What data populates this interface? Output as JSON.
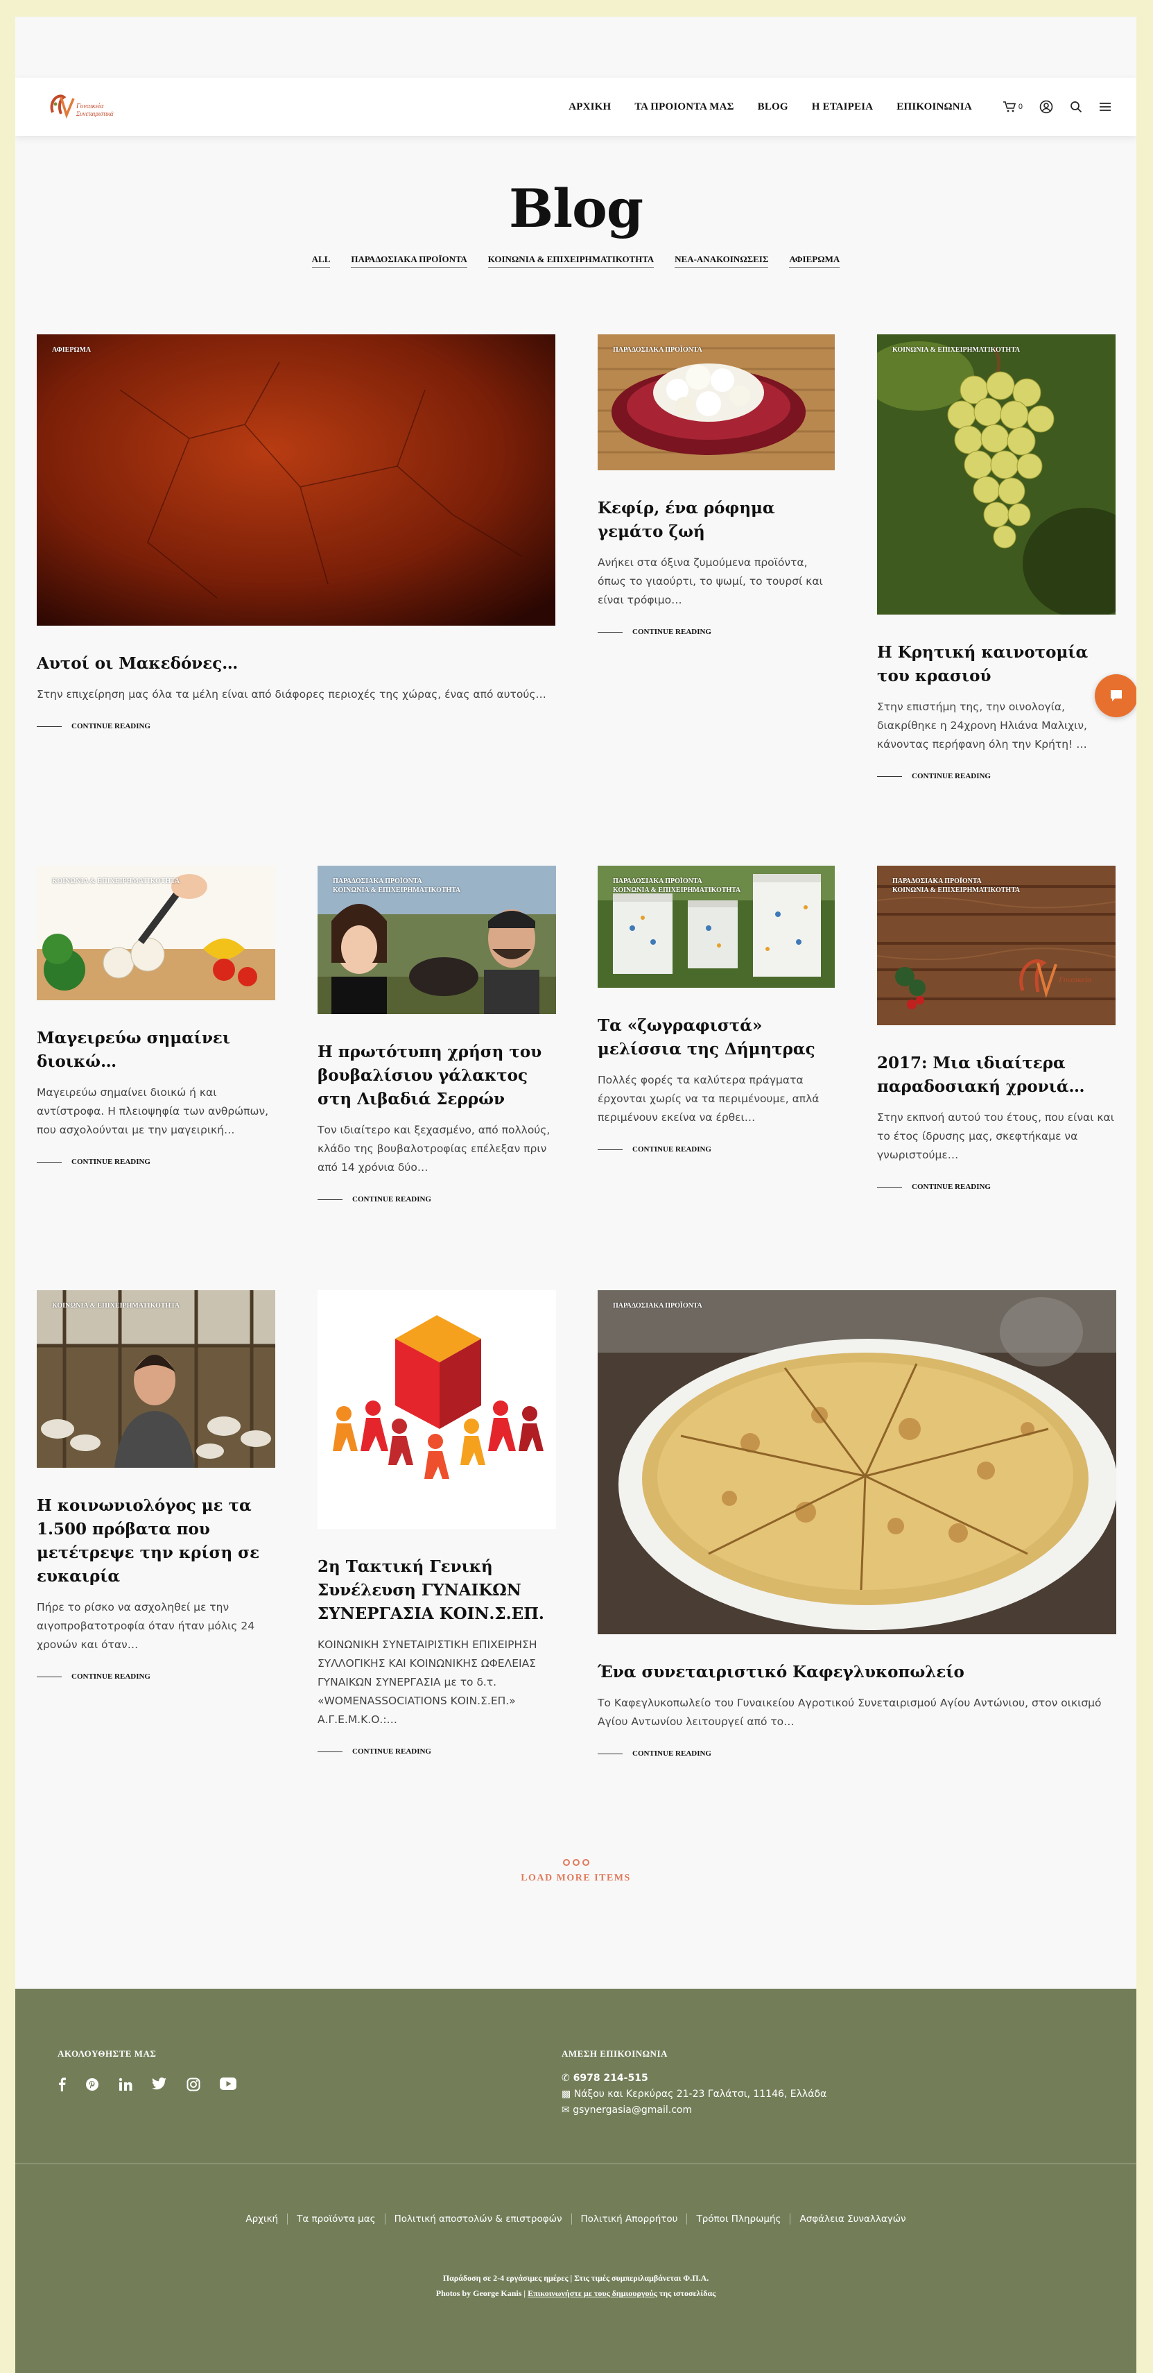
{
  "header": {
    "logo_text": "Γυναικεία Συνεταιριστικά",
    "nav": [
      "ΑΡΧΙΚΗ",
      "ΤΑ ΠΡΟΙΟΝΤΑ ΜΑΣ",
      "BLOG",
      "Η ΕΤΑΙΡΕΙΑ",
      "ΕΠΙΚΟΙΝΩΝΙΑ"
    ],
    "cart_count": "0",
    "icons": [
      "cart-icon",
      "user-icon",
      "search-icon",
      "menu-icon"
    ]
  },
  "page_title": "Blog",
  "filters": [
    "ALL",
    "ΠΑΡΑΔΟΣΙΑΚΑ ΠΡΟΪΟΝΤΑ",
    "ΚΟΙΝΩΝΙΑ & ΕΠΙΧΕΙΡΗΜΑΤΙΚΟΤΗΤΑ",
    "ΝΕΑ-ΑΝΑΚΟΙΝΩΣΕΙΣ",
    "ΑΦΙΕΡΩΜΑ"
  ],
  "continue_label": "CONTINUE READING",
  "posts": [
    {
      "category": "ΑΦΙΕΡΩΜΑ",
      "title": "Αυτοί οι Μακεδόνες…",
      "excerpt": "Στην επιχείρηση μας όλα τα μέλη είναι από διάφορες περιοχές της χώρας, ένας από αυτούς…"
    },
    {
      "category": "ΠΑΡΑΔΟΣΙΑΚΑ ΠΡΟΪΟΝΤΑ",
      "title": "Κεφίρ, ένα ρόφημα γεμάτο ζωή",
      "excerpt": "Ανήκει στα όξινα ζυμούμενα προϊόντα, όπως το γιαούρτι, το ψωμί, το τουρσί και είναι τρόφιμο…"
    },
    {
      "category": "ΚΟΙΝΩΝΙΑ & ΕΠΙΧΕΙΡΗΜΑΤΙΚΟΤΗΤΑ",
      "title": "Η Κρητική καινοτομία του κρασιού",
      "excerpt": "Στην επιστήμη της, την οινολογία, διακρίθηκε η 24χρονη Ηλιάνα Μαλιχιν, κάνοντας περήφανη όλη την Κρήτη! …"
    },
    {
      "category": "ΚΟΙΝΩΝΙΑ & ΕΠΙΧΕΙΡΗΜΑΤΙΚΟΤΗΤΑ",
      "title": "Μαγειρεύω σημαίνει διοικώ…",
      "excerpt": "Μαγειρεύω σημαίνει διοικώ ή και αντίστροφα. Η πλειοψηφία των ανθρώπων, που ασχολούνται με την μαγειρική…"
    },
    {
      "category": "ΠΑΡΑΔΟΣΙΑΚΑ ΠΡΟΪΟΝΤΑ\nΚΟΙΝΩΝΙΑ & ΕΠΙΧΕΙΡΗΜΑΤΙΚΟΤΗΤΑ",
      "title": "Η πρωτότυπη χρήση του βουβαλίσιου γάλακτος στη Λιβαδιά Σερρών",
      "excerpt": "Τον ιδιαίτερο και ξεχασμένο, από πολλούς, κλάδο της βουβαλοτροφίας επέλεξαν πριν από 14 χρόνια δύο…"
    },
    {
      "category": "ΠΑΡΑΔΟΣΙΑΚΑ ΠΡΟΪΟΝΤΑ\nΚΟΙΝΩΝΙΑ & ΕΠΙΧΕΙΡΗΜΑΤΙΚΟΤΗΤΑ",
      "title": "Τα «ζωγραφιστά» μελίσσια της Δήμητρας",
      "excerpt": "Πολλές φορές τα καλύτερα πράγματα έρχονται χωρίς να τα περιμένουμε, απλά περιμένουν εκείνα να έρθει…"
    },
    {
      "category": "ΠΑΡΑΔΟΣΙΑΚΑ ΠΡΟΪΟΝΤΑ\nΚΟΙΝΩΝΙΑ & ΕΠΙΧΕΙΡΗΜΑΤΙΚΟΤΗΤΑ",
      "title": "2017: Μια ιδιαίτερα παραδοσιακή χρονιά…",
      "excerpt": "Στην εκπνοή αυτού του έτους, που είναι και το έτος ίδρυσης μας, σκεφτήκαμε να γνωριστούμε…"
    },
    {
      "category": "ΚΟΙΝΩΝΙΑ & ΕΠΙΧΕΙΡΗΜΑΤΙΚΟΤΗΤΑ",
      "title": "Η κοινωνιολόγος με τα 1.500 πρόβατα που μετέτρεψε την κρίση σε ευκαιρία",
      "excerpt": "Πήρε το ρίσκο να ασχοληθεί με την αιγοπροβατοτροφία όταν ήταν μόλις 24 χρονών και όταν…"
    },
    {
      "category": "",
      "title": "2η Τακτική Γενική Συνέλευση ΓΥΝΑΙΚΩΝ ΣΥΝΕΡΓΑΣΙΑ ΚΟΙΝ.Σ.ΕΠ.",
      "excerpt": "ΚΟΙΝΩΝΙΚΗ ΣΥΝΕΤΑΙΡΙΣΤΙΚΗ ΕΠΙΧΕΙΡΗΣΗ ΣΥΛΛΟΓΙΚΗΣ ΚΑΙ ΚΟΙΝΩΝΙΚΗΣ ΩΦΕΛΕΙΑΣ ΓΥΝΑΙΚΩΝ ΣΥΝΕΡΓΑΣΙΑ με το δ.τ. «WOMENASSOCIATIONS ΚΟΙΝ.Σ.ΕΠ.» Α.Γ.Ε.Μ.Κ.Ο.:…"
    },
    {
      "category": "ΠΑΡΑΔΟΣΙΑΚΑ ΠΡΟΪΟΝΤΑ",
      "title": "Ένα συνεταιριστικό Καφεγλυκοπωλείο",
      "excerpt": "Το Καφεγλυκοπωλείο του Γυναικείου Αγροτικού Συνεταιρισμού Αγίου Αντώνιου, στον οικισμό Αγίου Αντωνίου λειτουργεί από το…"
    }
  ],
  "load_more": "LOAD MORE ITEMS",
  "footer": {
    "follow_heading": "ΑΚΟΛΟΥΘΗΣΤΕ ΜΑΣ",
    "social_icons": [
      "facebook-icon",
      "pinterest-icon",
      "linkedin-icon",
      "twitter-icon",
      "instagram-icon",
      "youtube-icon"
    ],
    "contact_heading": "ΑΜΕΣΗ ΕΠΙΚΟΙΝΩΝΙΑ",
    "phone": "6978 214-515",
    "address": "Νάξου και Κερκύρας 21-23 Γαλάτσι, 11146, Ελλάδα",
    "email": "gsynergasia@gmail.com",
    "links": [
      "Αρχική",
      "Τα προϊόντα μας",
      "Πολιτική αποστολών & επιστροφών",
      "Πολιτική Απορρήτου",
      "Τρόποι Πληρωμής",
      "Ασφάλεια Συναλλαγών"
    ],
    "note_line1": "Παράδοση σε 2-4 εργάσιμες ημέρες | Στις τιμές συμπεριλαμβάνεται Φ.Π.Α.",
    "note_line2_prefix": "Photos by George Kanis | ",
    "note_line2_link": "Επικοινωνήστε με τους δημιουργούς",
    "note_line2_suffix": " της ιστοσελίδας"
  },
  "colors": {
    "accent": "#e0795b",
    "footer_bg": "#737e59",
    "page_bg": "#f8f8f8",
    "outer_bg": "#f3f2cc",
    "chat": "#e8702e"
  }
}
